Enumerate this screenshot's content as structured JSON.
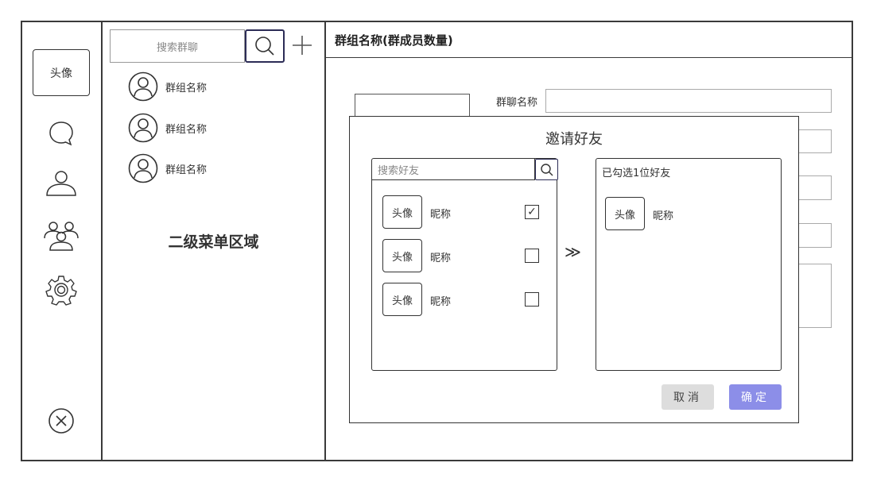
{
  "rail": {
    "avatar_label": "头像",
    "icons": [
      "chat-bubble-icon",
      "contact-icon",
      "group-icon",
      "settings-gear-icon",
      "close-circle-icon"
    ]
  },
  "secondary": {
    "search_placeholder": "搜索群聊",
    "groups": [
      {
        "label": "群组名称"
      },
      {
        "label": "群组名称"
      },
      {
        "label": "群组名称"
      }
    ],
    "caption": "二级菜单区域"
  },
  "main": {
    "header_title": "群组名称(群成员数量)",
    "form_label": "群聊名称"
  },
  "dialog": {
    "title": "邀请好友",
    "search_placeholder": "搜索好友",
    "friends": [
      {
        "avatar": "头像",
        "nickname": "昵称",
        "checked": true,
        "check_glyph": "✓"
      },
      {
        "avatar": "头像",
        "nickname": "昵称",
        "checked": false,
        "check_glyph": ""
      },
      {
        "avatar": "头像",
        "nickname": "昵称",
        "checked": false,
        "check_glyph": ""
      }
    ],
    "transfer_glyph": "≫",
    "selected_title": "已勾选1位好友",
    "selected": [
      {
        "avatar": "头像",
        "nickname": "昵称"
      }
    ],
    "cancel_label": "取消",
    "confirm_label": "确定"
  },
  "colors": {
    "border": "#3a3a3a",
    "confirm_bg": "#8c8ee8",
    "cancel_bg": "#dddddd",
    "search_btn_border": "#2c2c56"
  }
}
